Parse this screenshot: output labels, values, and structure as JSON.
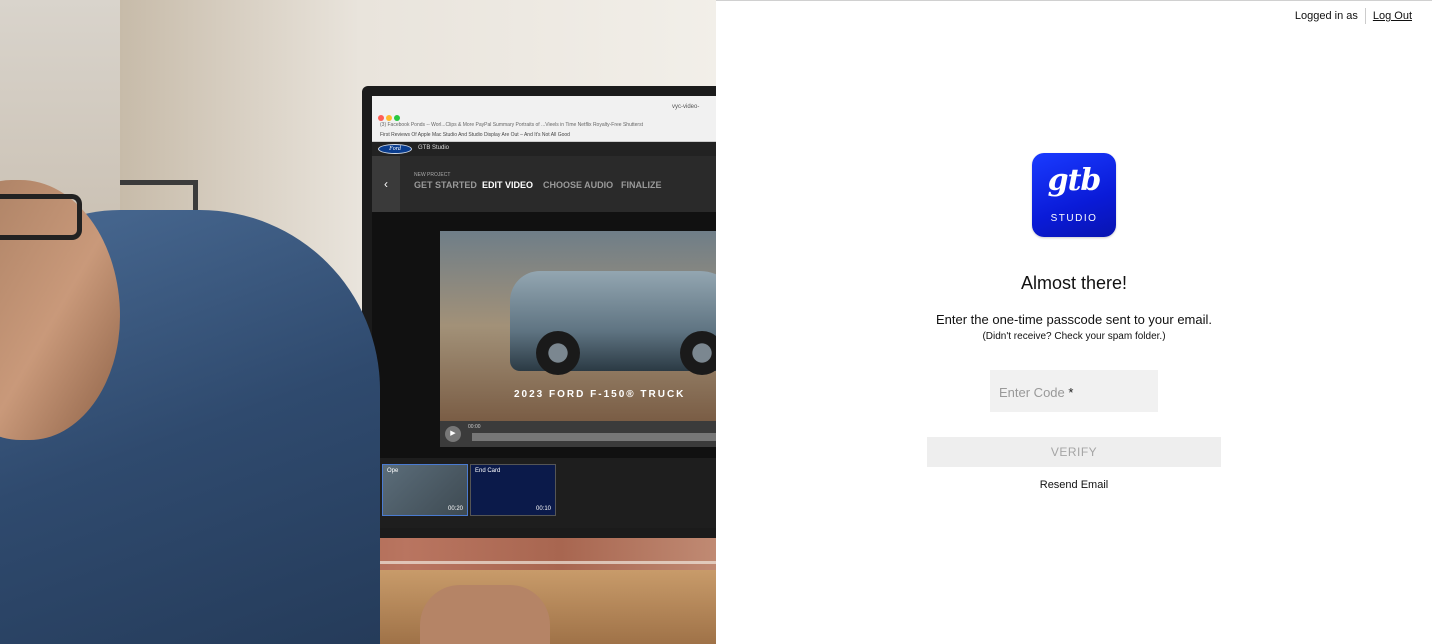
{
  "header": {
    "logged_in_label": "Logged in as",
    "logout_label": "Log Out"
  },
  "hero": {
    "browser": {
      "url": "vyc-video-",
      "bookmarks": "(3) Facebook   Ponds -- Worl...Clips & More   PayPal Summary   Portraits of ...Vieels in Time   Netflix   Royalty-Free   Shutterst",
      "tab_text": "First Reviews Of Apple Mac Studio And Studio Display Are Out – And It's Not All Good"
    },
    "app": {
      "brand": "Ford",
      "name": "GTB Studio",
      "new_project_label": "NEW PROJECT",
      "steps": [
        "GET STARTED",
        "EDIT VIDEO",
        "CHOOSE AUDIO",
        "FINALIZE"
      ],
      "active_step": "EDIT VIDEO",
      "video_title": "2023 FORD F-150® TRUCK",
      "timecode": "00:00",
      "clips": [
        {
          "label": "Ope",
          "duration": "00:20"
        },
        {
          "label": "End Card",
          "duration": "00:10"
        }
      ]
    }
  },
  "logo": {
    "mark": "gtb",
    "sub": "STUDIO",
    "color": "#1029e6"
  },
  "form": {
    "title": "Almost there!",
    "instruction": "Enter the one-time passcode sent to your email.",
    "hint": "(Didn't receive? Check your spam folder.)",
    "code_placeholder": "Enter Code",
    "required_marker": "*",
    "verify_label": "VERIFY",
    "resend_label": "Resend Email"
  }
}
